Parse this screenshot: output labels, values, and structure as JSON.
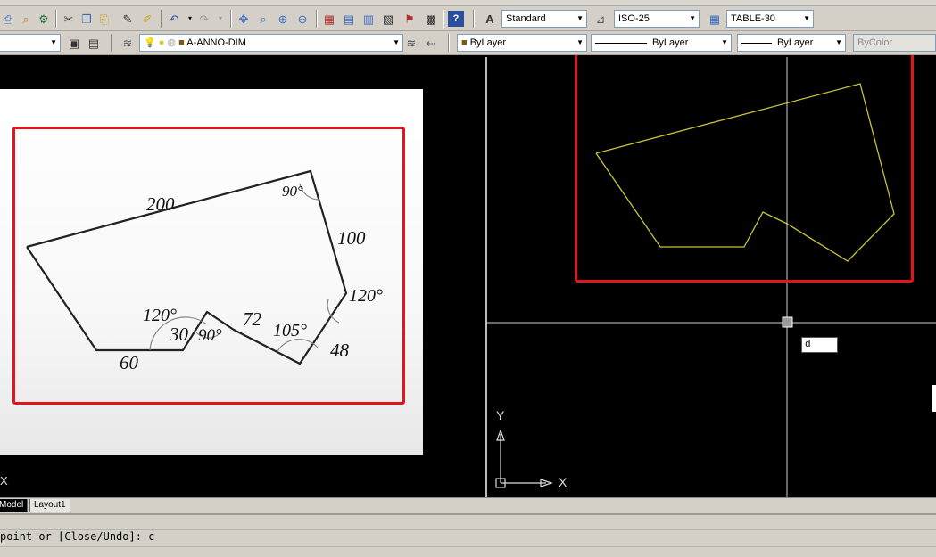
{
  "menus": [],
  "toolbar1": {
    "text_style": "Standard",
    "dim_style": "ISO-25",
    "table_style": "TABLE-30"
  },
  "toolbar2": {
    "layer": "A-ANNO-DIM",
    "color": "ByLayer",
    "linetype": "ByLayer",
    "lineweight": "ByLayer",
    "plotstyle": "ByColor"
  },
  "reference_sketch": {
    "dimensions": [
      "200",
      "90°",
      "100",
      "120°",
      "48",
      "105°",
      "72",
      "90°",
      "30",
      "120°",
      "60"
    ]
  },
  "viewport": {
    "command_input": "d",
    "ucs_x": "X",
    "ucs_y": "Y",
    "ucs_x_left": "X"
  },
  "layout_tabs": [
    "Model",
    "Layout1"
  ],
  "command_line": {
    "history": "point or [Close/Undo]: c"
  },
  "colors": {
    "accent_red": "#e3141b",
    "polyline_yellow": "#c9c23a",
    "crosshair": "#cfcfcf"
  }
}
